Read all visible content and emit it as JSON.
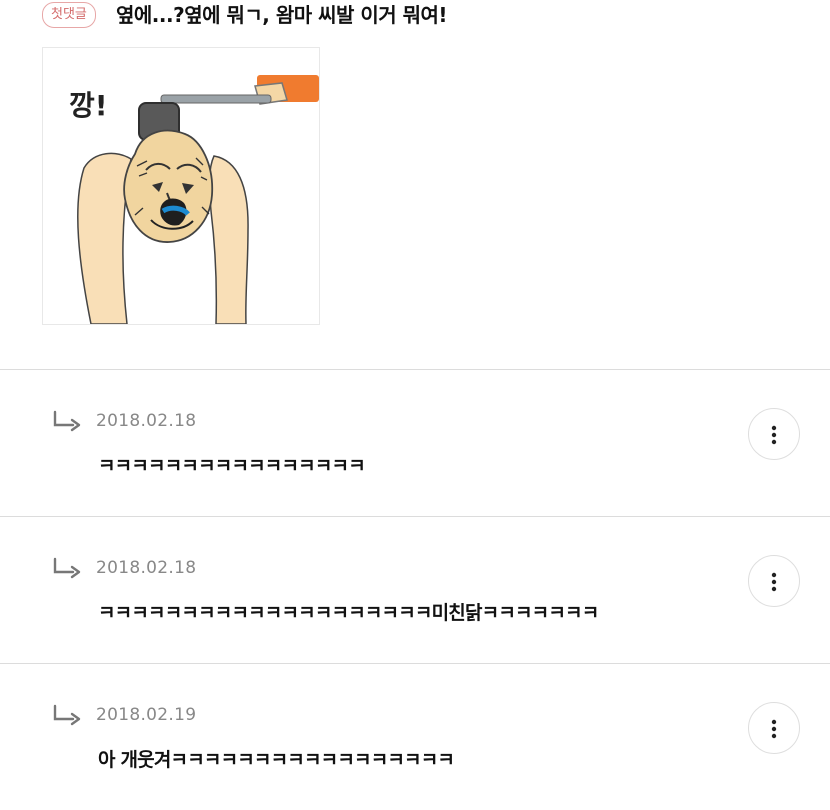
{
  "top_comment": {
    "badge_label": "첫댓글",
    "text": "옆에...?옆에 뭐ㄱ, 왐마 씨발 이거 뭐여!",
    "image": {
      "caption": "깡!",
      "icon": "meme-hammer-head-illustration"
    }
  },
  "replies": [
    {
      "date": "2018.02.18",
      "text": "ㅋㅋㅋㅋㅋㅋㅋㅋㅋㅋㅋㅋㅋㅋㅋㅋ",
      "more_icon": "more-vertical-icon"
    },
    {
      "date": "2018.02.18",
      "text": "ㅋㅋㅋㅋㅋㅋㅋㅋㅋㅋㅋㅋㅋㅋㅋㅋㅋㅋㅋㅋ미친닭ㅋㅋㅋㅋㅋㅋㅋ",
      "more_icon": "more-vertical-icon"
    },
    {
      "date": "2018.02.19",
      "text": "아 개웃겨ㅋㅋㅋㅋㅋㅋㅋㅋㅋㅋㅋㅋㅋㅋㅋㅋㅋ",
      "more_icon": "more-vertical-icon"
    }
  ],
  "colors": {
    "badge": "#d46b6b",
    "date": "#888888",
    "separator": "#dcdcdc",
    "hammer_handle": "#f07b2f"
  }
}
